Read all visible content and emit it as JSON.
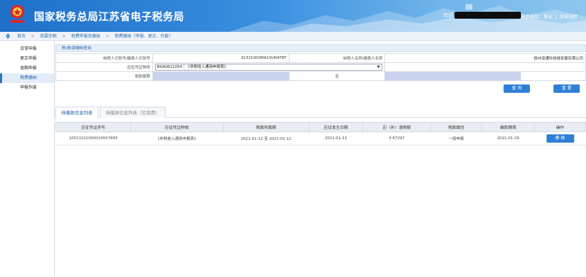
{
  "header": {
    "site_title": "国家税务总局江苏省电子税务局",
    "welcome_prefix": "欢迎",
    "login_role_label": "启用级别：暂无",
    "close_page_label": "关闭当页"
  },
  "breadcrumb": {
    "items": [
      "首页",
      "我要办税",
      "税费申报及缴纳",
      "税费缴纳（申报、更正、作废）"
    ]
  },
  "sidebar": {
    "items": [
      {
        "label": "日常申报",
        "active": false
      },
      {
        "label": "更正申报",
        "active": false
      },
      {
        "label": "逾期申报",
        "active": false
      },
      {
        "label": "税费缴纳",
        "active": true
      },
      {
        "label": "申报作废",
        "active": false
      }
    ]
  },
  "query_panel": {
    "title": "税(费)款缴纳查询",
    "taxpayer_id_label": "纳税人识别号/缴费人识别号",
    "taxpayer_id_value": "91321000MA1XUN4T8T",
    "taxpayer_name_label": "纳税人名称/缴费人名称",
    "taxpayer_name_value": "扬州润通科技城发展有限公司",
    "voucher_type_label": "应征凭证种类",
    "voucher_type_value": "BDA0611054｜《非税收入通用申报表》",
    "tax_period_label": "税款属期",
    "to_label": "至",
    "query_button": "查 询",
    "reset_button": "重 置"
  },
  "tabs": [
    {
      "label": "待缴款信息列表",
      "active": true
    },
    {
      "label": "待缴款信息列表（社保费）",
      "active": false
    }
  ],
  "table": {
    "columns": [
      "应征凭证序号",
      "应征凭证种类",
      "税款所属期",
      "应征发生日期",
      "应（补）退税额",
      "税款属性",
      "缴款期限",
      "操作"
    ],
    "rows": [
      {
        "voucher_no": "10013221000019557693",
        "voucher_type": "《非税收入通用申报表》",
        "period": "2021-01-12 至 2021-01-12",
        "occur_date": "2021-01-12",
        "amount": "¥ 67297",
        "attribute": "一般申报",
        "deadline": "2021-01-29",
        "action": "缴 纳"
      }
    ]
  },
  "colors": {
    "header_blue": "#1d6fc8",
    "accent": "#2f7fd6",
    "emblem_red": "#d8262a"
  },
  "icons": {
    "emblem": "national-tax-emblem",
    "breadcrumb": "location-pin-icon",
    "dropdown": "dropdown-caret-icon"
  }
}
